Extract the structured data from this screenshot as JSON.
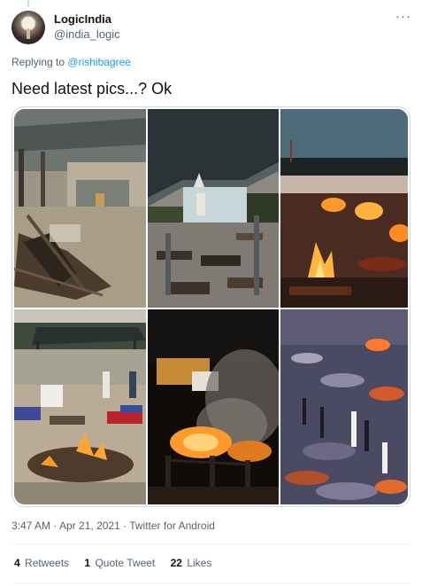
{
  "author": {
    "display_name": "LogicIndia",
    "handle": "@india_logic",
    "avatar_icon": "avatar-candle-image"
  },
  "more_menu": {
    "glyph": "···",
    "icon": "more-horizontal-icon"
  },
  "reply_context": {
    "prefix": "Replying to",
    "mention": "@rishibagree"
  },
  "tweet": {
    "text": "Need latest pics...? Ok"
  },
  "media": {
    "photo_count": 6,
    "photos": [
      {
        "name": "photo-1",
        "scene": "cremation-shed-pyres"
      },
      {
        "name": "photo-2",
        "scene": "cremation-ground-under-roof"
      },
      {
        "name": "photo-3",
        "scene": "burning-pyres-at-dusk"
      },
      {
        "name": "photo-4",
        "scene": "open-ground-pyres"
      },
      {
        "name": "photo-5",
        "scene": "night-pyres-smoke"
      },
      {
        "name": "photo-6",
        "scene": "crowded-pyres-aerial"
      }
    ]
  },
  "meta": {
    "time": "3:47 AM",
    "separator1": " · ",
    "date": "Apr 21, 2021",
    "separator2": " · ",
    "source": "Twitter for Android"
  },
  "stats": {
    "retweets": {
      "count": "4",
      "label": "Retweets"
    },
    "quotes": {
      "count": "1",
      "label": "Quote Tweet"
    },
    "likes": {
      "count": "22",
      "label": "Likes"
    }
  },
  "colors": {
    "link": "#1d9bf0",
    "secondary_text": "#536471",
    "primary_text": "#0f1419",
    "border": "#cfd9de"
  }
}
